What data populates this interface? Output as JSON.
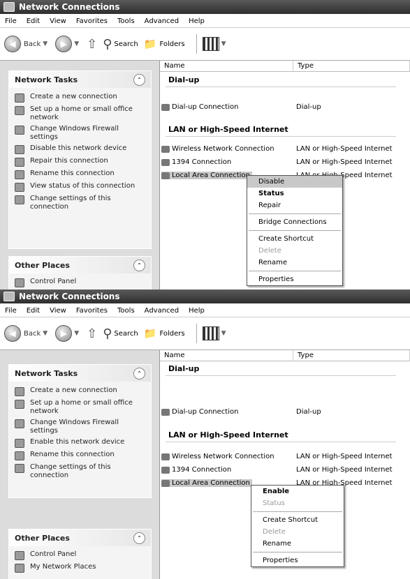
{
  "title": "Network Connections",
  "menu": [
    "File",
    "Edit",
    "View",
    "Favorites",
    "Tools",
    "Advanced",
    "Help"
  ],
  "toolbar": {
    "back": "Back",
    "search": "Search",
    "folders": "Folders"
  },
  "columns": {
    "name": "Name",
    "type": "Type"
  },
  "sidebar": {
    "network_tasks": "Network Tasks",
    "other_places": "Other Places",
    "other_items": [
      "Control Panel",
      "My Network Places"
    ]
  },
  "groups": {
    "dialup": "Dial-up",
    "lan": "LAN or High-Speed Internet"
  },
  "connections": {
    "dialup": {
      "name": "Dial-up Connection",
      "type": "Dial-up"
    },
    "wireless": {
      "name": "Wireless Network Connection",
      "type": "LAN or High-Speed Internet"
    },
    "c1394": {
      "name": "1394 Connection",
      "type": "LAN or High-Speed Internet"
    },
    "local": {
      "name": "Local Area Connection",
      "type": "LAN or High-Speed Internet"
    }
  },
  "screen1": {
    "tasks": [
      "Create a new connection",
      "Set up a home or small office network",
      "Change Windows Firewall settings",
      "Disable this network device",
      "Repair this connection",
      "Rename this connection",
      "View status of this connection",
      "Change settings of this connection"
    ],
    "context_menu": [
      "Disable",
      "Status",
      "Repair",
      "Bridge Connections",
      "Create Shortcut",
      "Delete",
      "Rename",
      "Properties"
    ]
  },
  "screen2": {
    "tasks": [
      "Create a new connection",
      "Set up a home or small office network",
      "Change Windows Firewall settings",
      "Enable this network device",
      "Rename this connection",
      "Change settings of this connection"
    ],
    "context_menu": [
      "Enable",
      "Status",
      "Create Shortcut",
      "Delete",
      "Rename",
      "Properties"
    ]
  }
}
